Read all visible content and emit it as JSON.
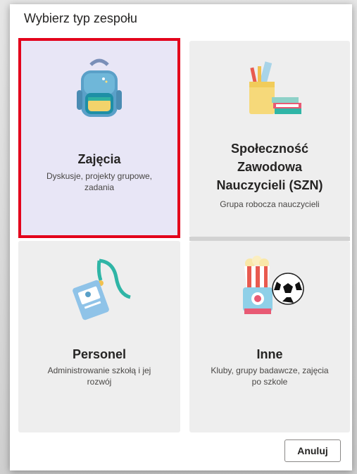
{
  "dialog": {
    "title": "Wybierz typ zespołu",
    "cancel_label": "Anuluj"
  },
  "cards": [
    {
      "title": "Zajęcia",
      "description": "Dyskusje, projekty grupowe, zadania",
      "icon": "backpack-icon",
      "selected": true
    },
    {
      "title": "Społeczność Zawodowa Nauczycieli (SZN)",
      "description": "Grupa robocza nauczycieli",
      "icon": "pencil-cup-books-icon",
      "selected": false
    },
    {
      "title": "Personel",
      "description": "Administrowanie szkołą i jej rozwój",
      "icon": "id-badge-lanyard-icon",
      "selected": false
    },
    {
      "title": "Inne",
      "description": "Kluby, grupy badawcze, zajęcia po szkole",
      "icon": "popcorn-camera-ball-icon",
      "selected": false
    }
  ],
  "colors": {
    "selection_border": "#e3001b",
    "selected_bg": "#e8e6f6",
    "card_bg": "#eeeeee"
  }
}
